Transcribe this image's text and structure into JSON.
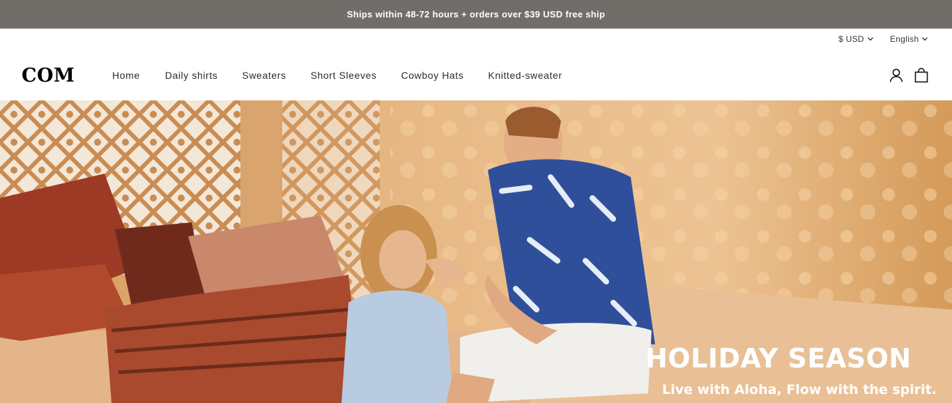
{
  "announcement": {
    "text": "Ships within 48-72 hours + orders over $39 USD free ship"
  },
  "localization": {
    "currency": "$ USD",
    "language": "English"
  },
  "header": {
    "logo": "COM",
    "nav": [
      {
        "label": "Home"
      },
      {
        "label": "Daily shirts"
      },
      {
        "label": "Sweaters"
      },
      {
        "label": "Short Sleeves"
      },
      {
        "label": "Cowboy Hats"
      },
      {
        "label": "Knitted-sweater"
      }
    ],
    "icons": {
      "account": "account-icon",
      "cart": "cart-icon"
    }
  },
  "hero": {
    "title": "HOLIDAY SEASON",
    "subtitle": "Live with Aloha, Flow with the spirit."
  },
  "colors": {
    "announcement_bg": "#716e69",
    "hero_warm": "#d9a36a",
    "text": "#121212"
  }
}
